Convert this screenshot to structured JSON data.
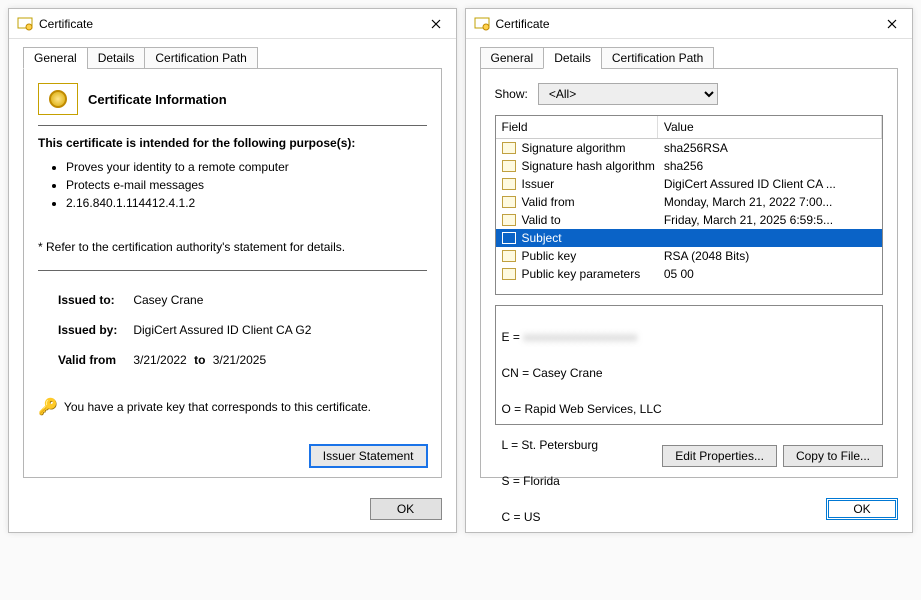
{
  "general_dialog": {
    "title": "Certificate",
    "tabs": {
      "general": "General",
      "details": "Details",
      "path": "Certification Path"
    },
    "cert_info_title": "Certificate Information",
    "purpose_heading": "This certificate is intended for the following purpose(s):",
    "purposes": [
      "Proves your identity to a remote computer",
      "Protects e-mail messages",
      "2.16.840.1.114412.4.1.2"
    ],
    "refer_note": "* Refer to the certification authority's statement for details.",
    "issued_to_label": "Issued to:",
    "issued_to_value": "Casey Crane",
    "issued_by_label": "Issued by:",
    "issued_by_value": "DigiCert Assured ID Client CA G2",
    "valid_from_label": "Valid from",
    "valid_from_value": "3/21/2022",
    "valid_to_sep": "to",
    "valid_to_value": "3/21/2025",
    "key_note": "You have a private key that corresponds to this certificate.",
    "issuer_statement_btn": "Issuer Statement",
    "ok_btn": "OK"
  },
  "details_dialog": {
    "title": "Certificate",
    "tabs": {
      "general": "General",
      "details": "Details",
      "path": "Certification Path"
    },
    "show_label": "Show:",
    "show_value": "<All>",
    "col_field": "Field",
    "col_value": "Value",
    "rows": [
      {
        "field": "Signature algorithm",
        "value": "sha256RSA"
      },
      {
        "field": "Signature hash algorithm",
        "value": "sha256"
      },
      {
        "field": "Issuer",
        "value": "DigiCert Assured ID Client CA ..."
      },
      {
        "field": "Valid from",
        "value": "Monday, March 21, 2022 7:00..."
      },
      {
        "field": "Valid to",
        "value": "Friday, March 21, 2025 6:59:5..."
      },
      {
        "field": "Subject",
        "value": ""
      },
      {
        "field": "Public key",
        "value": "RSA (2048 Bits)"
      },
      {
        "field": "Public key parameters",
        "value": "05 00"
      }
    ],
    "selected_index": 5,
    "subject_lines": {
      "e_label": "E = ",
      "e_value_masked": "xxxxxxxxxxxxxxxxxxx",
      "cn": "CN = Casey Crane",
      "o": "O = Rapid Web Services, LLC",
      "l": "L = St. Petersburg",
      "s": "S = Florida",
      "c": "C = US"
    },
    "edit_props_btn": "Edit Properties...",
    "copy_file_btn": "Copy to File...",
    "ok_btn": "OK"
  }
}
